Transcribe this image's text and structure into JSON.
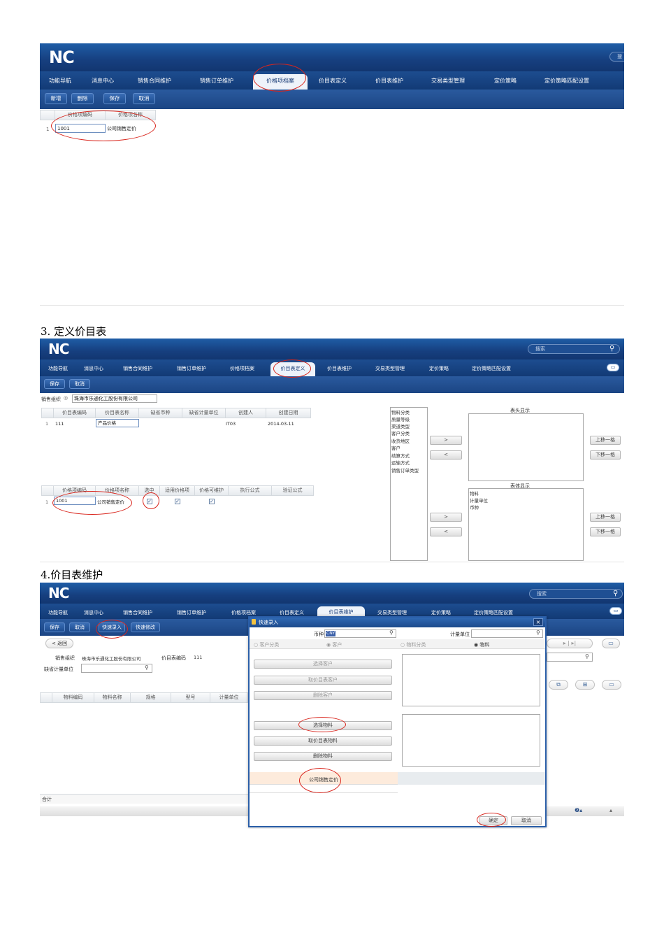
{
  "screen1": {
    "logo": "NC",
    "search_text": "搜",
    "nav": [
      "功能导航",
      "消息中心",
      "销售合同维护",
      "销售订单维护",
      "价格项档案",
      "价目表定义",
      "价目表维护",
      "交易类型管理",
      "定价策略",
      "定价策略匹配设置"
    ],
    "active_nav": "价格项档案",
    "buttons": [
      "新增",
      "删除",
      "保存",
      "取消"
    ],
    "columns": [
      "价格项编码",
      "价格项名称"
    ],
    "row": {
      "no": "1",
      "code": "1001",
      "name": "公司销售定价"
    }
  },
  "section3": "3. 定义价目表",
  "screen2": {
    "logo": "NC",
    "search_placeholder": "搜索",
    "nav": [
      "功能导航",
      "消息中心",
      "销售合同维护",
      "销售订单维护",
      "价格项档案",
      "价目表定义",
      "价目表维护",
      "交易类型管理",
      "定价策略",
      "定价策略匹配设置"
    ],
    "active_nav": "价目表定义",
    "buttons": [
      "保存",
      "取消"
    ],
    "org_label": "销售组织",
    "org_value": "珠海市乐通化工股份有限公司",
    "top_columns": [
      "价目表编码",
      "价目表名称",
      "缺省币种",
      "缺省计量单位",
      "创建人",
      "创建日期"
    ],
    "top_row": {
      "no": "1",
      "code": "111",
      "name": "产品价格",
      "creator": "IT03",
      "date": "2014-03-11"
    },
    "bottom_columns": [
      "价格项编码",
      "价格项名称",
      "选中",
      "适用价格项",
      "价格可维护",
      "执行公式",
      "验证公式"
    ],
    "bottom_row": {
      "no": "1",
      "code": "1001",
      "name": "公司销售定价"
    },
    "dimension_list": [
      "物料分类",
      "质量等级",
      "渠道类型",
      "客户分类",
      "收货地区",
      "客户",
      "结算方式",
      "运输方式",
      "销售订单类型"
    ],
    "header_display_title": "表头显示",
    "body_display_title": "表体显示",
    "body_display_items": [
      "物料",
      "计量单位",
      "币种"
    ],
    "move_right": ">",
    "move_left": "<",
    "move_up": "上移一格",
    "move_down": "下移一格"
  },
  "section4": "4.价目表维护",
  "screen3": {
    "logo": "NC",
    "search_placeholder": "搜索",
    "nav": [
      "功能导航",
      "消息中心",
      "销售合同维护",
      "销售订单维护",
      "价格项档案",
      "价目表定义",
      "价目表维护",
      "交易类型管理",
      "定价策略",
      "定价策略匹配设置"
    ],
    "active_nav": "价目表维护",
    "buttons": [
      "保存",
      "取消",
      "快速录入",
      "快速修改"
    ],
    "back_label": "< 返回",
    "org_label": "销售组织",
    "org_value": "珠海市乐通化工股份有限公司",
    "pricelist_code_label": "价目表编码",
    "pricelist_code_value": "111",
    "unit_label": "缺省计量单位",
    "columns": [
      "物料编码",
      "物料名称",
      "规格",
      "型号",
      "计量单位"
    ],
    "total_label": "合计",
    "dialog": {
      "title": "快速录入",
      "close": "×",
      "currency_label": "币种",
      "currency_value": "CNY",
      "unit_label": "计量单位",
      "radio_customer_class": "客户分类",
      "radio_customer": "客户",
      "radio_material_class": "物料分类",
      "radio_material": "物料",
      "btn_select_customer": "选择客户",
      "btn_take_customer": "取价目表客户",
      "btn_delete_customer": "删除客户",
      "btn_select_material": "选择物料",
      "btn_take_material": "取价目表物料",
      "btn_delete_material": "删除物料",
      "price_item": "公司销售定价",
      "ok": "确定",
      "cancel": "取消"
    }
  }
}
